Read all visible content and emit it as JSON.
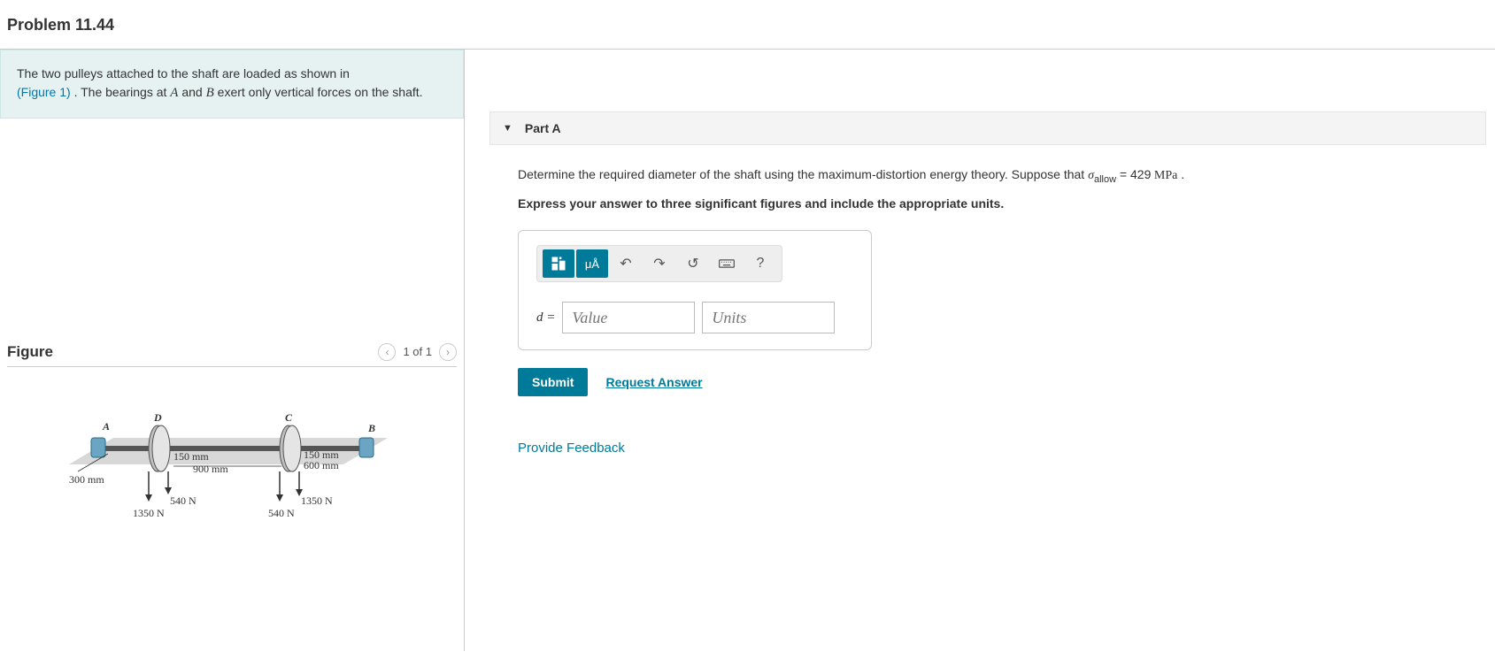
{
  "page_title": "Problem 11.44",
  "problem_statement": {
    "line1": "The two pulleys attached to the shaft are loaded as shown in",
    "figure_link": "(Figure 1)",
    "line2": " . The bearings at ",
    "varA": "A",
    "line3": " and ",
    "varB": "B",
    "line4": " exert only vertical forces on the shaft."
  },
  "figure": {
    "title": "Figure",
    "pager": "1 of 1",
    "labels": {
      "A": "A",
      "B": "B",
      "C": "C",
      "D": "D",
      "dim_300": "300 mm",
      "dim_150a": "150 mm",
      "dim_900": "900 mm",
      "dim_150b": "150 mm",
      "dim_600": "600 mm",
      "force_540a": "540 N",
      "force_1350a": "1350 N",
      "force_540b": "540 N",
      "force_1350b": "1350 N"
    }
  },
  "partA": {
    "label": "Part A",
    "question_pre": "Determine the required diameter of the shaft using the maximum-distortion energy theory. Suppose that ",
    "sigma": "σ",
    "sigma_sub": "allow",
    "eq": " = 429",
    "unit": "  MPa",
    "period": " .",
    "instruction": "Express your answer to three significant figures and include the appropriate units.",
    "var_label": "d =",
    "value_placeholder": "Value",
    "units_placeholder": "Units",
    "toolbar_mu": "μÅ",
    "submit_label": "Submit",
    "request_label": "Request Answer"
  },
  "feedback_label": "Provide Feedback"
}
